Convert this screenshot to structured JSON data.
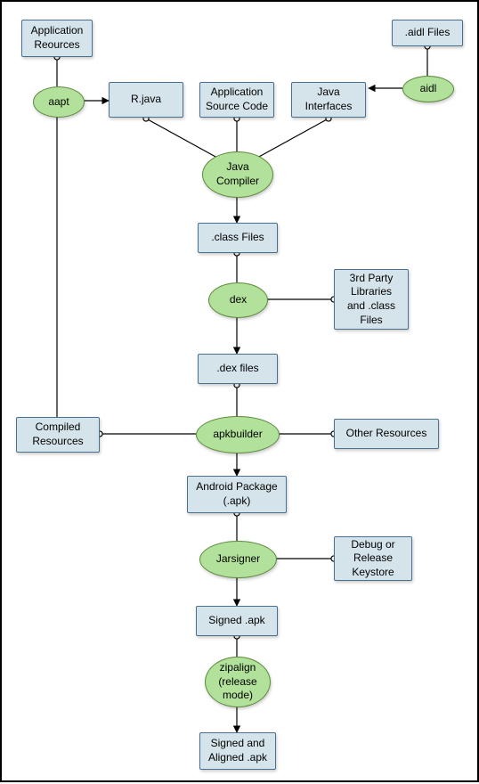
{
  "nodes": {
    "app_resources": "Application\nReources",
    "aidl_files": ".aidl Files",
    "aapt": "aapt",
    "aidl": "aidl",
    "r_java": "R.java",
    "app_src": "Application\nSource Code",
    "java_if": "Java\nInterfaces",
    "java_compiler": "Java\nCompiler",
    "class_files": ".class Files",
    "dex": "dex",
    "third_party": "3rd Party\nLibraries\nand .class\nFiles",
    "dex_files": ".dex files",
    "compiled_res": "Compiled\nResources",
    "apkbuilder": "apkbuilder",
    "other_res": "Other Resources",
    "android_pkg": "Android Package\n(.apk)",
    "jarsigner": "Jarsigner",
    "keystore": "Debug or\nRelease\nKeystore",
    "signed_apk": "Signed .apk",
    "zipalign": "zipalign\n(release\nmode)",
    "signed_aligned": "Signed and\nAligned .apk"
  },
  "colors": {
    "box_fill": "#d5e4ea",
    "box_stroke": "#4a7090",
    "ellipse_fill": "#b1e19a",
    "ellipse_stroke": "#5e8a3d"
  },
  "chart_data": {
    "type": "flowchart",
    "nodes": [
      {
        "id": "app_resources",
        "label": "Application Reources",
        "type": "box"
      },
      {
        "id": "aidl_files",
        "label": ".aidl Files",
        "type": "box"
      },
      {
        "id": "aapt",
        "label": "aapt",
        "type": "process"
      },
      {
        "id": "aidl",
        "label": "aidl",
        "type": "process"
      },
      {
        "id": "r_java",
        "label": "R.java",
        "type": "box"
      },
      {
        "id": "app_src",
        "label": "Application Source Code",
        "type": "box"
      },
      {
        "id": "java_if",
        "label": "Java Interfaces",
        "type": "box"
      },
      {
        "id": "java_compiler",
        "label": "Java Compiler",
        "type": "process"
      },
      {
        "id": "class_files",
        "label": ".class Files",
        "type": "box"
      },
      {
        "id": "dex",
        "label": "dex",
        "type": "process"
      },
      {
        "id": "third_party",
        "label": "3rd Party Libraries and .class Files",
        "type": "box"
      },
      {
        "id": "dex_files",
        "label": ".dex files",
        "type": "box"
      },
      {
        "id": "compiled_res",
        "label": "Compiled Resources",
        "type": "box"
      },
      {
        "id": "apkbuilder",
        "label": "apkbuilder",
        "type": "process"
      },
      {
        "id": "other_res",
        "label": "Other Resources",
        "type": "box"
      },
      {
        "id": "android_pkg",
        "label": "Android Package (.apk)",
        "type": "box"
      },
      {
        "id": "jarsigner",
        "label": "Jarsigner",
        "type": "process"
      },
      {
        "id": "keystore",
        "label": "Debug or Release Keystore",
        "type": "box"
      },
      {
        "id": "signed_apk",
        "label": "Signed .apk",
        "type": "box"
      },
      {
        "id": "zipalign",
        "label": "zipalign (release mode)",
        "type": "process"
      },
      {
        "id": "signed_aligned",
        "label": "Signed and Aligned .apk",
        "type": "box"
      }
    ],
    "edges": [
      {
        "from": "app_resources",
        "to": "aapt",
        "style": "input"
      },
      {
        "from": "aapt",
        "to": "r_java",
        "style": "output"
      },
      {
        "from": "aapt",
        "to": "compiled_res",
        "style": "output"
      },
      {
        "from": "aidl_files",
        "to": "aidl",
        "style": "input"
      },
      {
        "from": "aidl",
        "to": "java_if",
        "style": "output"
      },
      {
        "from": "r_java",
        "to": "java_compiler",
        "style": "input"
      },
      {
        "from": "app_src",
        "to": "java_compiler",
        "style": "input"
      },
      {
        "from": "java_if",
        "to": "java_compiler",
        "style": "input"
      },
      {
        "from": "java_compiler",
        "to": "class_files",
        "style": "output"
      },
      {
        "from": "class_files",
        "to": "dex",
        "style": "input"
      },
      {
        "from": "third_party",
        "to": "dex",
        "style": "input"
      },
      {
        "from": "dex",
        "to": "dex_files",
        "style": "output"
      },
      {
        "from": "dex_files",
        "to": "apkbuilder",
        "style": "input"
      },
      {
        "from": "compiled_res",
        "to": "apkbuilder",
        "style": "input"
      },
      {
        "from": "other_res",
        "to": "apkbuilder",
        "style": "input"
      },
      {
        "from": "apkbuilder",
        "to": "android_pkg",
        "style": "output"
      },
      {
        "from": "android_pkg",
        "to": "jarsigner",
        "style": "input"
      },
      {
        "from": "keystore",
        "to": "jarsigner",
        "style": "input"
      },
      {
        "from": "jarsigner",
        "to": "signed_apk",
        "style": "output"
      },
      {
        "from": "signed_apk",
        "to": "zipalign",
        "style": "input"
      },
      {
        "from": "zipalign",
        "to": "signed_aligned",
        "style": "output"
      }
    ]
  }
}
